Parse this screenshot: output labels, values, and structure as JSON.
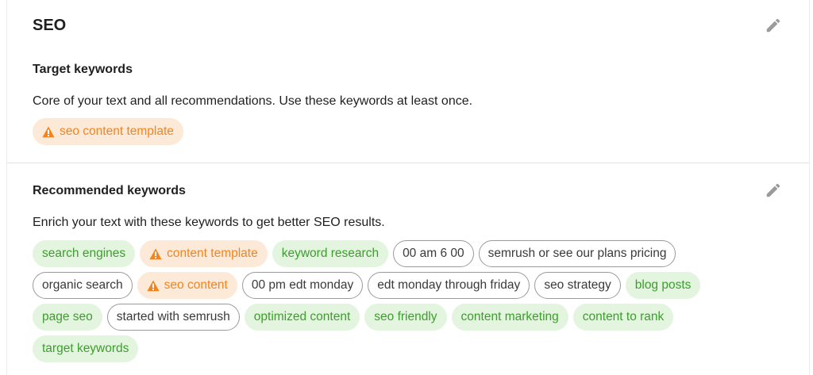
{
  "section_title": "SEO",
  "target": {
    "heading": "Target keywords",
    "description": "Core of your text and all recommendations. Use these keywords at least once.",
    "keywords": [
      {
        "label": "seo content template",
        "status": "warning"
      }
    ]
  },
  "recommended": {
    "heading": "Recommended keywords",
    "description": "Enrich your text with these keywords to get better SEO results.",
    "keywords": [
      {
        "label": "search engines",
        "status": "used"
      },
      {
        "label": "content template",
        "status": "warning"
      },
      {
        "label": "keyword research",
        "status": "used"
      },
      {
        "label": "00 am 6 00",
        "status": "unused"
      },
      {
        "label": "semrush or see our plans pricing",
        "status": "unused"
      },
      {
        "label": "organic search",
        "status": "unused"
      },
      {
        "label": "seo content",
        "status": "warning"
      },
      {
        "label": "00 pm edt monday",
        "status": "unused"
      },
      {
        "label": "edt monday through friday",
        "status": "unused"
      },
      {
        "label": "seo strategy",
        "status": "unused"
      },
      {
        "label": "blog posts",
        "status": "used"
      },
      {
        "label": "page seo",
        "status": "used"
      },
      {
        "label": "started with semrush",
        "status": "unused"
      },
      {
        "label": "optimized content",
        "status": "used"
      },
      {
        "label": "seo friendly",
        "status": "used"
      },
      {
        "label": "content marketing",
        "status": "used"
      },
      {
        "label": "content to rank",
        "status": "used"
      },
      {
        "label": "target keywords",
        "status": "used"
      }
    ]
  },
  "icons": {
    "edit": "pencil-icon",
    "warning": "warning-triangle-icon"
  },
  "colors": {
    "used_bg": "#e3f4df",
    "used_text": "#3c9e2c",
    "warning_bg": "#fde9d8",
    "warning_text": "#f0851f",
    "unused_border": "#9a9a9a",
    "icon_gray": "#9b9b9b"
  }
}
